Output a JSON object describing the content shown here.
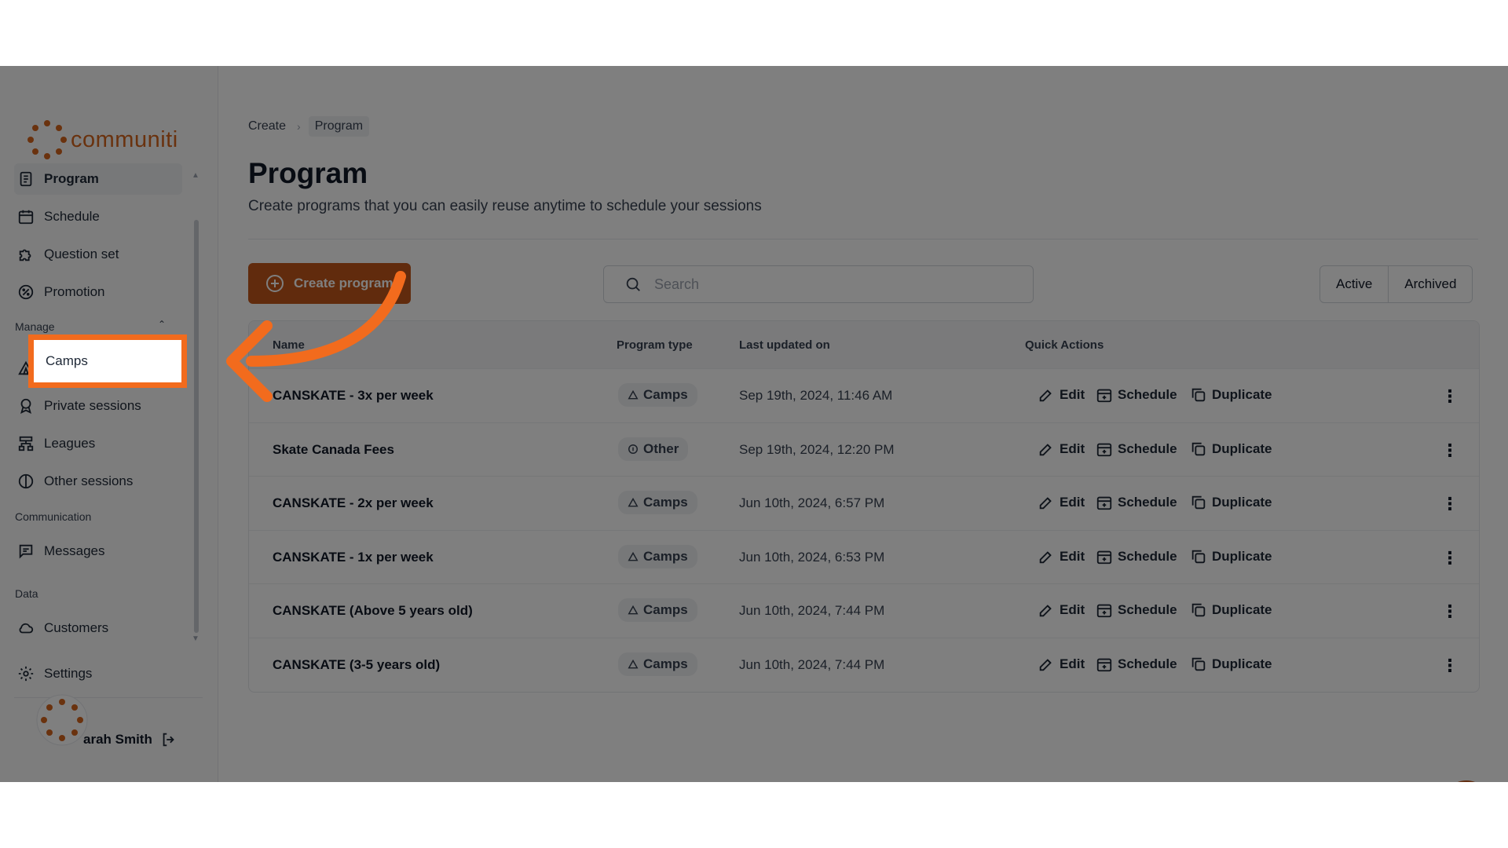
{
  "brand": {
    "name": "communiti"
  },
  "sidebar": {
    "items": [
      {
        "label": "Program",
        "icon": "clipboard-icon"
      },
      {
        "label": "Schedule",
        "icon": "calendar-plus-icon"
      },
      {
        "label": "Question set",
        "icon": "puzzle-icon"
      },
      {
        "label": "Promotion",
        "icon": "percent-icon"
      }
    ],
    "manage_label": "Manage",
    "manage_items": [
      {
        "label": "Camps",
        "icon": "tent-icon"
      },
      {
        "label": "Private sessions",
        "icon": "award-icon"
      },
      {
        "label": "Leagues",
        "icon": "network-icon"
      },
      {
        "label": "Other sessions",
        "icon": "half-circle-icon"
      }
    ],
    "communication_label": "Communication",
    "communication_items": [
      {
        "label": "Messages",
        "icon": "message-icon"
      }
    ],
    "data_label": "Data",
    "data_items": [
      {
        "label": "Customers",
        "icon": "cloud-icon"
      }
    ],
    "settings_label": "Settings",
    "user_name": "arah Smith"
  },
  "breadcrumb": {
    "parent": "Create",
    "current": "Program"
  },
  "page": {
    "title": "Program",
    "subtitle": "Create programs that you can easily reuse anytime to schedule your sessions"
  },
  "toolbar": {
    "create_label": "Create program",
    "search_placeholder": "Search",
    "filter_active": "Active",
    "filter_archived": "Archived"
  },
  "table": {
    "headers": {
      "name": "Name",
      "type": "Program type",
      "updated": "Last updated on",
      "actions": "Quick Actions"
    },
    "actions": {
      "edit": "Edit",
      "schedule": "Schedule",
      "duplicate": "Duplicate"
    },
    "rows": [
      {
        "name": "CANSKATE - 3x per week",
        "type": "Camps",
        "updated": "Sep 19th, 2024, 11:46 AM"
      },
      {
        "name": "Skate Canada Fees",
        "type": "Other",
        "updated": "Sep 19th, 2024, 12:20 PM"
      },
      {
        "name": "CANSKATE - 2x per week",
        "type": "Camps",
        "updated": "Jun 10th, 2024, 6:57 PM"
      },
      {
        "name": "CANSKATE - 1x per week",
        "type": "Camps",
        "updated": "Jun 10th, 2024, 6:53 PM"
      },
      {
        "name": "CANSKATE (Above 5 years old)",
        "type": "Camps",
        "updated": "Jun 10th, 2024, 7:44 PM"
      },
      {
        "name": "CANSKATE (3-5 years old)",
        "type": "Camps",
        "updated": "Jun 10th, 2024, 7:44 PM"
      }
    ]
  },
  "colors": {
    "brand": "#c2561a",
    "highlight": "#f26b1d"
  }
}
